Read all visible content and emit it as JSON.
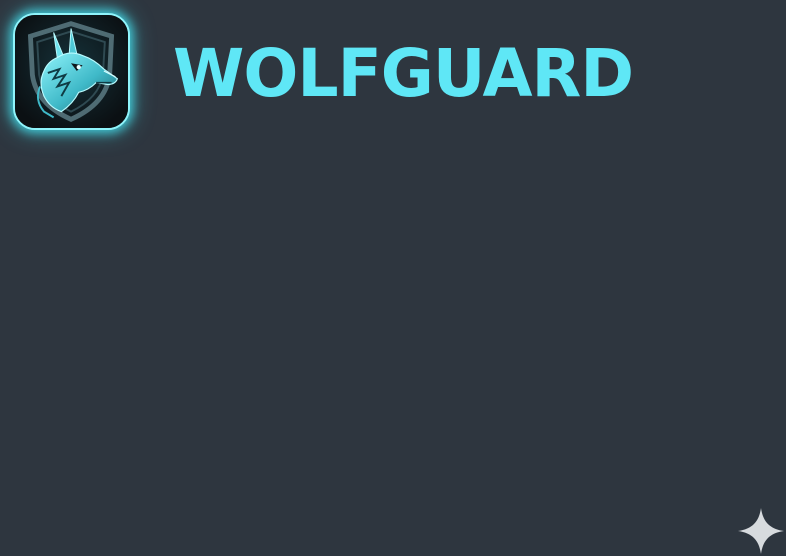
{
  "brand": {
    "name": "WOLFGUARD",
    "icon": "wolf-shield-icon"
  },
  "corner_mark": {
    "icon": "sparkle-icon"
  },
  "colors": {
    "background": "#2e363f",
    "accent": "#5fe7f6",
    "icon_glow": "#46e8f7",
    "icon_base": "#0f1519"
  }
}
